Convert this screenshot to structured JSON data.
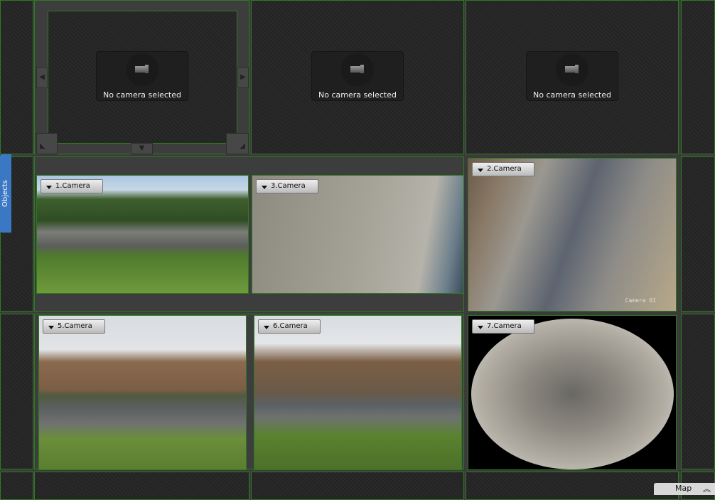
{
  "sidebar": {
    "objects_tab": "Objects"
  },
  "footer": {
    "map_tab": "Map"
  },
  "empty_slots": [
    {
      "text": "No camera selected"
    },
    {
      "text": "No camera selected"
    },
    {
      "text": "No camera selected"
    }
  ],
  "cameras": [
    {
      "label": "1.Camera"
    },
    {
      "label": "3.Camera"
    },
    {
      "label": "2.Camera",
      "overlay": "Camera 01"
    },
    {
      "label": "5.Camera"
    },
    {
      "label": "6.Camera"
    },
    {
      "label": "7.Camera"
    }
  ],
  "colors": {
    "border": "#2f7a22",
    "objects_tab": "#3b78c4"
  }
}
